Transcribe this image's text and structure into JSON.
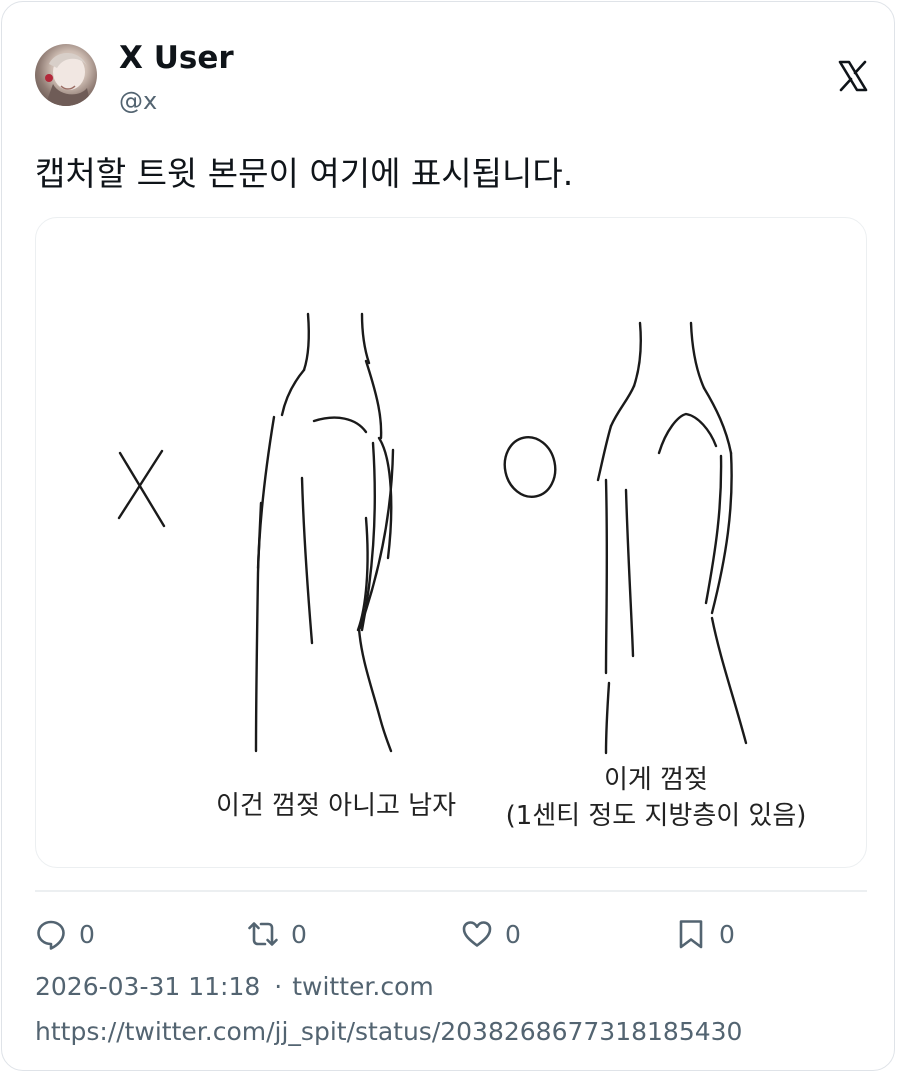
{
  "author": {
    "display_name": "X User",
    "handle": "@x",
    "avatar_icon": "profile-avatar"
  },
  "platform_icon": "x-logo-icon",
  "tweet": {
    "text": "캡처할 트윗 본문이 여기에 표시됩니다."
  },
  "media": {
    "left_mark": "X",
    "right_mark": "O",
    "caption_left": "이건 껌젖 아니고 남자",
    "caption_right_line1": "이게 껌젖",
    "caption_right_line2": "(1센티 정도 지방층이 있음)"
  },
  "actions": {
    "reply": {
      "icon": "reply-icon",
      "count": "0"
    },
    "retweet": {
      "icon": "retweet-icon",
      "count": "0"
    },
    "like": {
      "icon": "heart-icon",
      "count": "0"
    },
    "bookmark": {
      "icon": "bookmark-icon",
      "count": "0"
    }
  },
  "meta": {
    "timestamp": "2026-03-31 11:18",
    "separator": "·",
    "source": "twitter.com",
    "url": "https://twitter.com/jj_spit/status/2038268677318185430"
  },
  "colors": {
    "text_primary": "#0f1419",
    "text_secondary": "#536471",
    "border": "#dfe3e8"
  }
}
